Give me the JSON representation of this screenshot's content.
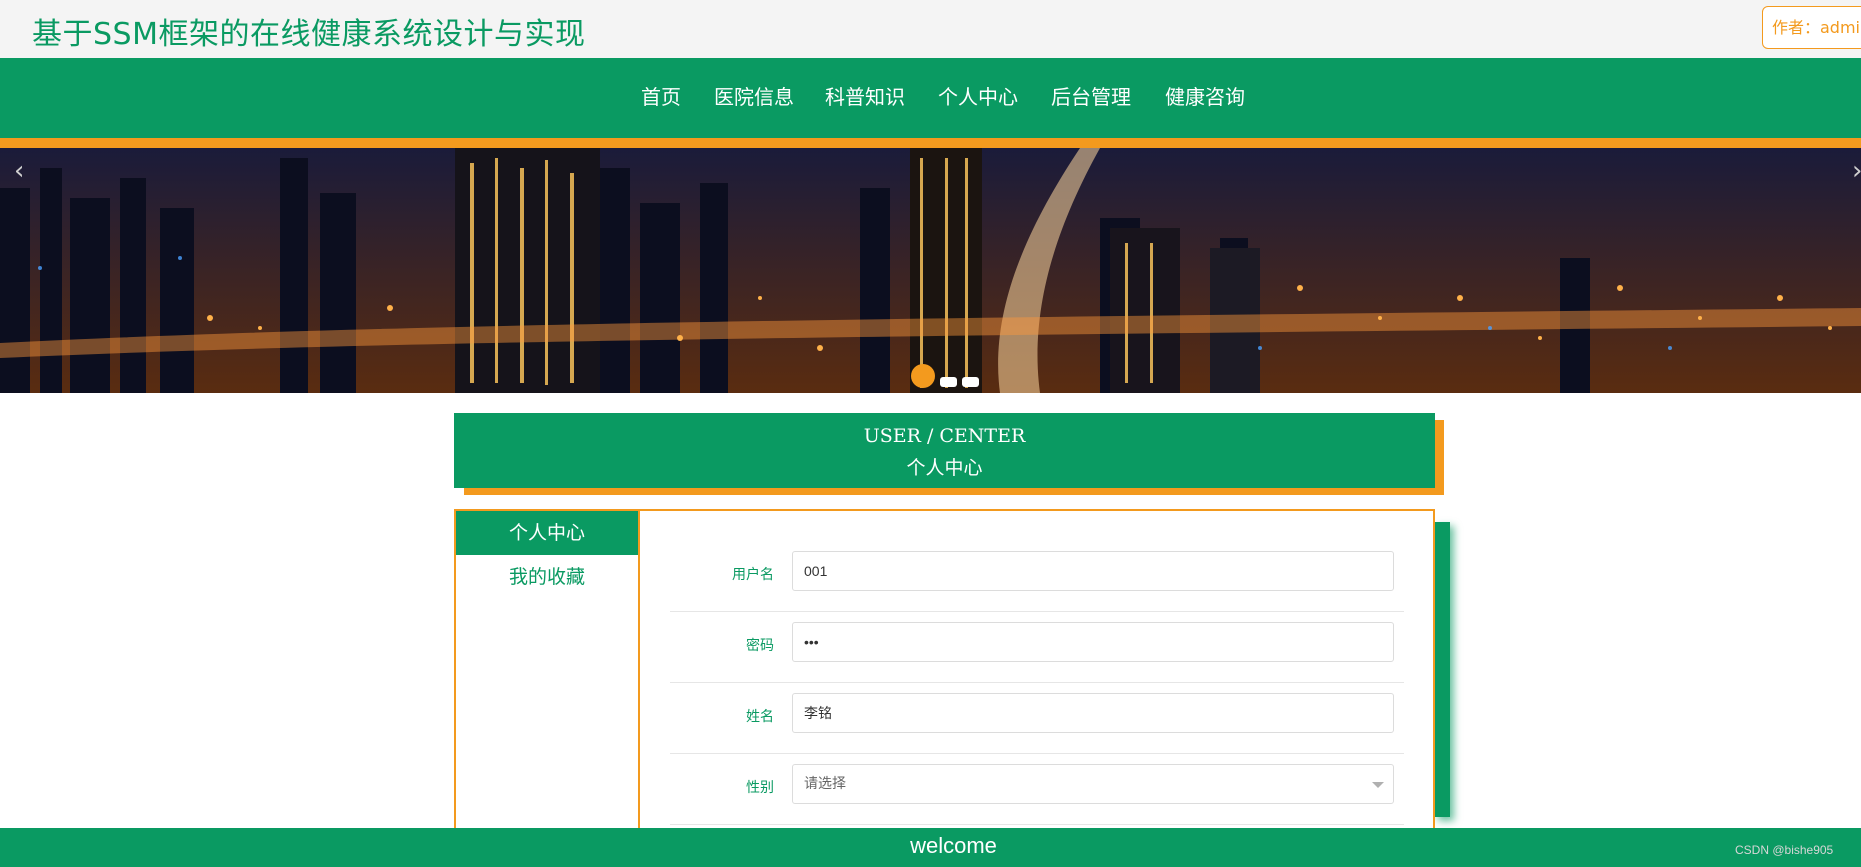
{
  "header": {
    "site_title": "基于SSM框架的在线健康系统设计与实现",
    "author_label": "作者：admin"
  },
  "nav": {
    "items": [
      {
        "label": "首页"
      },
      {
        "label": "医院信息"
      },
      {
        "label": "科普知识"
      },
      {
        "label": "个人中心"
      },
      {
        "label": "后台管理"
      },
      {
        "label": "健康咨询"
      }
    ]
  },
  "banner": {
    "prev_icon": "chevron-left-icon",
    "next_icon": "chevron-right-icon",
    "slide_count": 3,
    "active_slide": 1
  },
  "section": {
    "title_en": "USER / CENTER",
    "title_cn": "个人中心"
  },
  "sidebar": {
    "items": [
      {
        "label": "个人中心",
        "active": true
      },
      {
        "label": "我的收藏",
        "active": false
      }
    ]
  },
  "form": {
    "username": {
      "label": "用户名",
      "value": "001"
    },
    "password": {
      "label": "密码",
      "value": "•••"
    },
    "name": {
      "label": "姓名",
      "value": "李铭"
    },
    "gender": {
      "label": "性别",
      "placeholder": "请选择"
    }
  },
  "footer": {
    "text": "welcome",
    "watermark": "CSDN @bishe905"
  },
  "colors": {
    "primary_green": "#0a9a62",
    "accent_orange": "#f39a1e"
  }
}
